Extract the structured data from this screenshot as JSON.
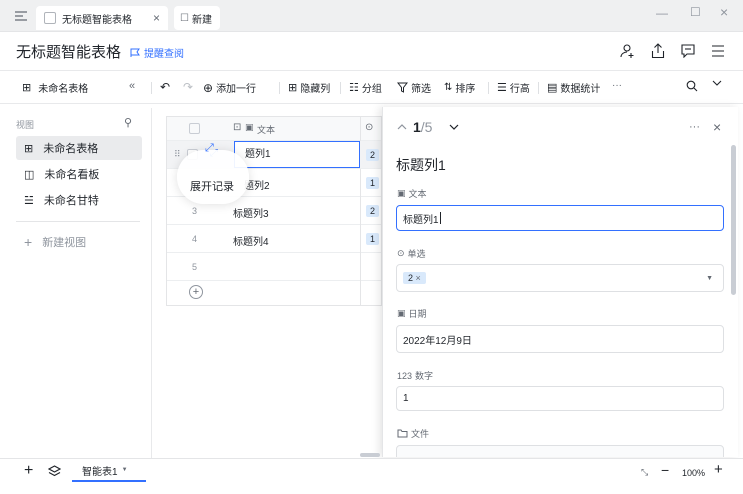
{
  "tabs": [
    {
      "label": "无标题智能表格",
      "active": true
    },
    {
      "label": "新建",
      "active": false
    }
  ],
  "doc": {
    "title": "无标题智能表格",
    "remind": "提醒查阅"
  },
  "toolbar": {
    "view_name": "未命名表格",
    "add_row": "添加一行",
    "hide_col": "隐藏列",
    "group": "分组",
    "filter": "筛选",
    "sort": "排序",
    "row_height": "行高",
    "stats": "数据统计",
    "more": "···"
  },
  "sidebar": {
    "header": "视图",
    "items": [
      {
        "label": "未命名表格",
        "icon": "table-icon",
        "active": true
      },
      {
        "label": "未命名看板",
        "icon": "kanban-icon",
        "active": false
      },
      {
        "label": "未命名甘特",
        "icon": "gantt-icon",
        "active": false
      }
    ],
    "new_view": "新建视图"
  },
  "grid": {
    "col_header": "文本",
    "rows": [
      {
        "num": "",
        "text": "题列1",
        "tag": "2"
      },
      {
        "num": "",
        "text": "题列2",
        "tag": "1"
      },
      {
        "num": "3",
        "text": "标题列3",
        "tag": "2"
      },
      {
        "num": "4",
        "text": "标题列4",
        "tag": "1"
      },
      {
        "num": "5",
        "text": "",
        "tag": ""
      }
    ],
    "expand_tooltip": "展开记录"
  },
  "panel": {
    "current": "1",
    "total": "/5",
    "record_title": "标题列1",
    "fields": {
      "text_label": "文本",
      "text_value": "标题列1",
      "select_label": "单选",
      "select_value": "2",
      "date_label": "日期",
      "date_value": "2022年12月9日",
      "number_label": "数字",
      "number_prefix": "123",
      "number_value": "1",
      "file_label": "文件"
    }
  },
  "bottom": {
    "sheet_tab": "智能表1",
    "zoom": "100%"
  },
  "colors": {
    "accent": "#3370ff",
    "tag_bg": "#d9e9fb",
    "selected_bg": "#eaebed"
  }
}
